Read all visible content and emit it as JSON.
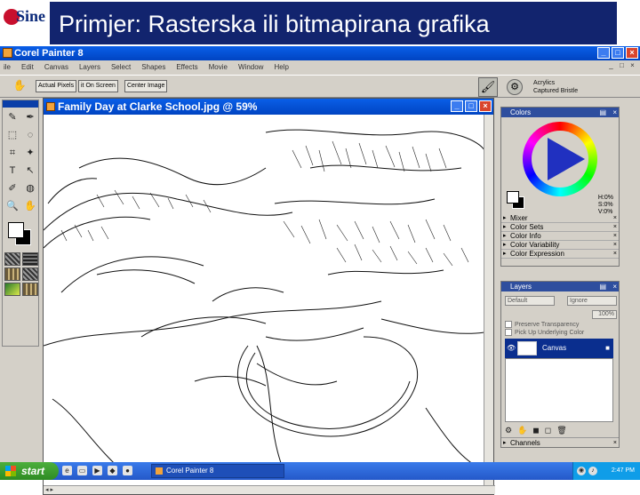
{
  "slide": {
    "title": "Primjer: Rasterska ili bitmapirana grafika",
    "logo_text": "Sine",
    "title_bar_color": "#12246e"
  },
  "app": {
    "title": "Corel Painter 8",
    "menu": [
      "ile",
      "Edit",
      "Canvas",
      "Layers",
      "Select",
      "Shapes",
      "Effects",
      "Movie",
      "Window",
      "Help"
    ],
    "window_buttons": [
      "_",
      "□",
      "×"
    ],
    "mdi_buttons": [
      "_",
      "□",
      "×"
    ],
    "titlebar_color": "#0a5fe8"
  },
  "property_bar": {
    "buttons": [
      "Actual Pixels",
      "it On Screen",
      "Center Image"
    ],
    "brush_category": "Acrylics",
    "brush_variant": "Captured Bristle"
  },
  "document": {
    "title": "Family Day at Clarke School.jpg @ 59%",
    "buttons": [
      "_",
      "□",
      "×"
    ]
  },
  "colors_panel": {
    "title": "Colors",
    "hsv": [
      "H:0%",
      "S:0%",
      "V:0%"
    ],
    "subpanels": [
      "Mixer",
      "Color Sets",
      "Color Info",
      "Color Variability",
      "Color Expression"
    ]
  },
  "layers_panel": {
    "title": "Layers",
    "composite_method": "Default",
    "composite_depth": "Ignore",
    "opacity": "100%",
    "preserve_transparency": "Preserve Transparency",
    "pick_up_underlying": "Pick Up Underlying Color",
    "layer_name": "Canvas",
    "channels": "Channels"
  },
  "taskbar": {
    "start": "start",
    "task_button": "Corel Painter 8",
    "clock": "2:47 PM"
  }
}
